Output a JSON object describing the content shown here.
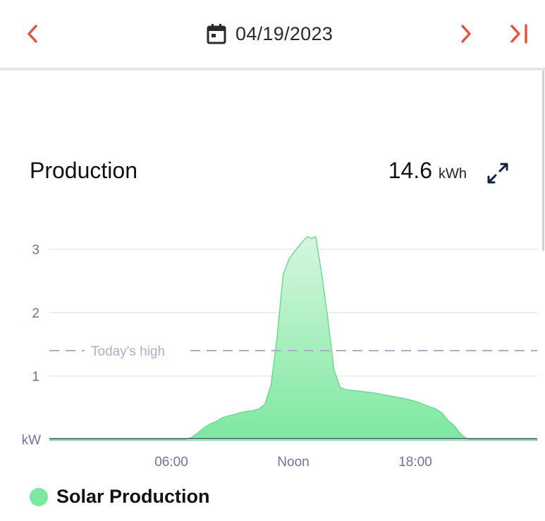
{
  "header": {
    "date": "04/19/2023",
    "icons": {
      "prev": "chevron-left-icon",
      "calendar": "calendar-icon",
      "next": "chevron-right-icon",
      "last": "skip-to-end-icon"
    }
  },
  "production": {
    "title": "Production",
    "total_value": "14.6",
    "total_unit": "kWh",
    "expand_icon": "expand-icon"
  },
  "colors": {
    "accent_red": "#e0533f",
    "fill_top": "#d6f6df",
    "fill_bottom": "#7ee8a0",
    "line": "#6fd893",
    "reference_line": "#aab0c4",
    "axis_text": "#6b7597",
    "grid": "#e8e8ea",
    "baseline": "#4d5a6e"
  },
  "chart_data": {
    "type": "area",
    "x_unit": "hours",
    "xlim": [
      0,
      24
    ],
    "ylim": [
      0,
      3.2
    ],
    "ylabel": "kW",
    "y_ticks": [
      {
        "value": 1,
        "label": "1"
      },
      {
        "value": 2,
        "label": "2"
      },
      {
        "value": 3,
        "label": "3"
      }
    ],
    "x_ticks": [
      {
        "value": 6,
        "label": "06:00"
      },
      {
        "value": 12,
        "label": "Noon"
      },
      {
        "value": 18,
        "label": "18:00"
      }
    ],
    "grid": true,
    "reference_line": {
      "value": 1.4,
      "label": "Today's high"
    },
    "series": [
      {
        "name": "Solar Production",
        "x": [
          0,
          6.7,
          7.0,
          7.3,
          7.6,
          7.9,
          8.2,
          8.5,
          8.8,
          9.1,
          9.4,
          9.7,
          10.0,
          10.3,
          10.6,
          10.9,
          11.2,
          11.5,
          11.8,
          12.1,
          12.4,
          12.7,
          12.9,
          13.1,
          13.4,
          13.7,
          14.0,
          14.3,
          14.6,
          15.0,
          15.5,
          16.0,
          16.5,
          17.0,
          17.5,
          18.0,
          18.5,
          19.0,
          19.3,
          19.6,
          19.9,
          20.2,
          20.4,
          20.6,
          24
        ],
        "y": [
          0,
          0,
          0.03,
          0.1,
          0.18,
          0.24,
          0.28,
          0.34,
          0.37,
          0.39,
          0.42,
          0.44,
          0.45,
          0.48,
          0.55,
          0.85,
          1.6,
          2.6,
          2.85,
          2.98,
          3.1,
          3.2,
          3.17,
          3.2,
          2.6,
          1.9,
          1.1,
          0.82,
          0.78,
          0.77,
          0.75,
          0.73,
          0.7,
          0.67,
          0.64,
          0.6,
          0.54,
          0.48,
          0.42,
          0.3,
          0.22,
          0.1,
          0.04,
          0.0,
          0
        ]
      }
    ]
  },
  "legend": {
    "label": "Solar Production"
  }
}
